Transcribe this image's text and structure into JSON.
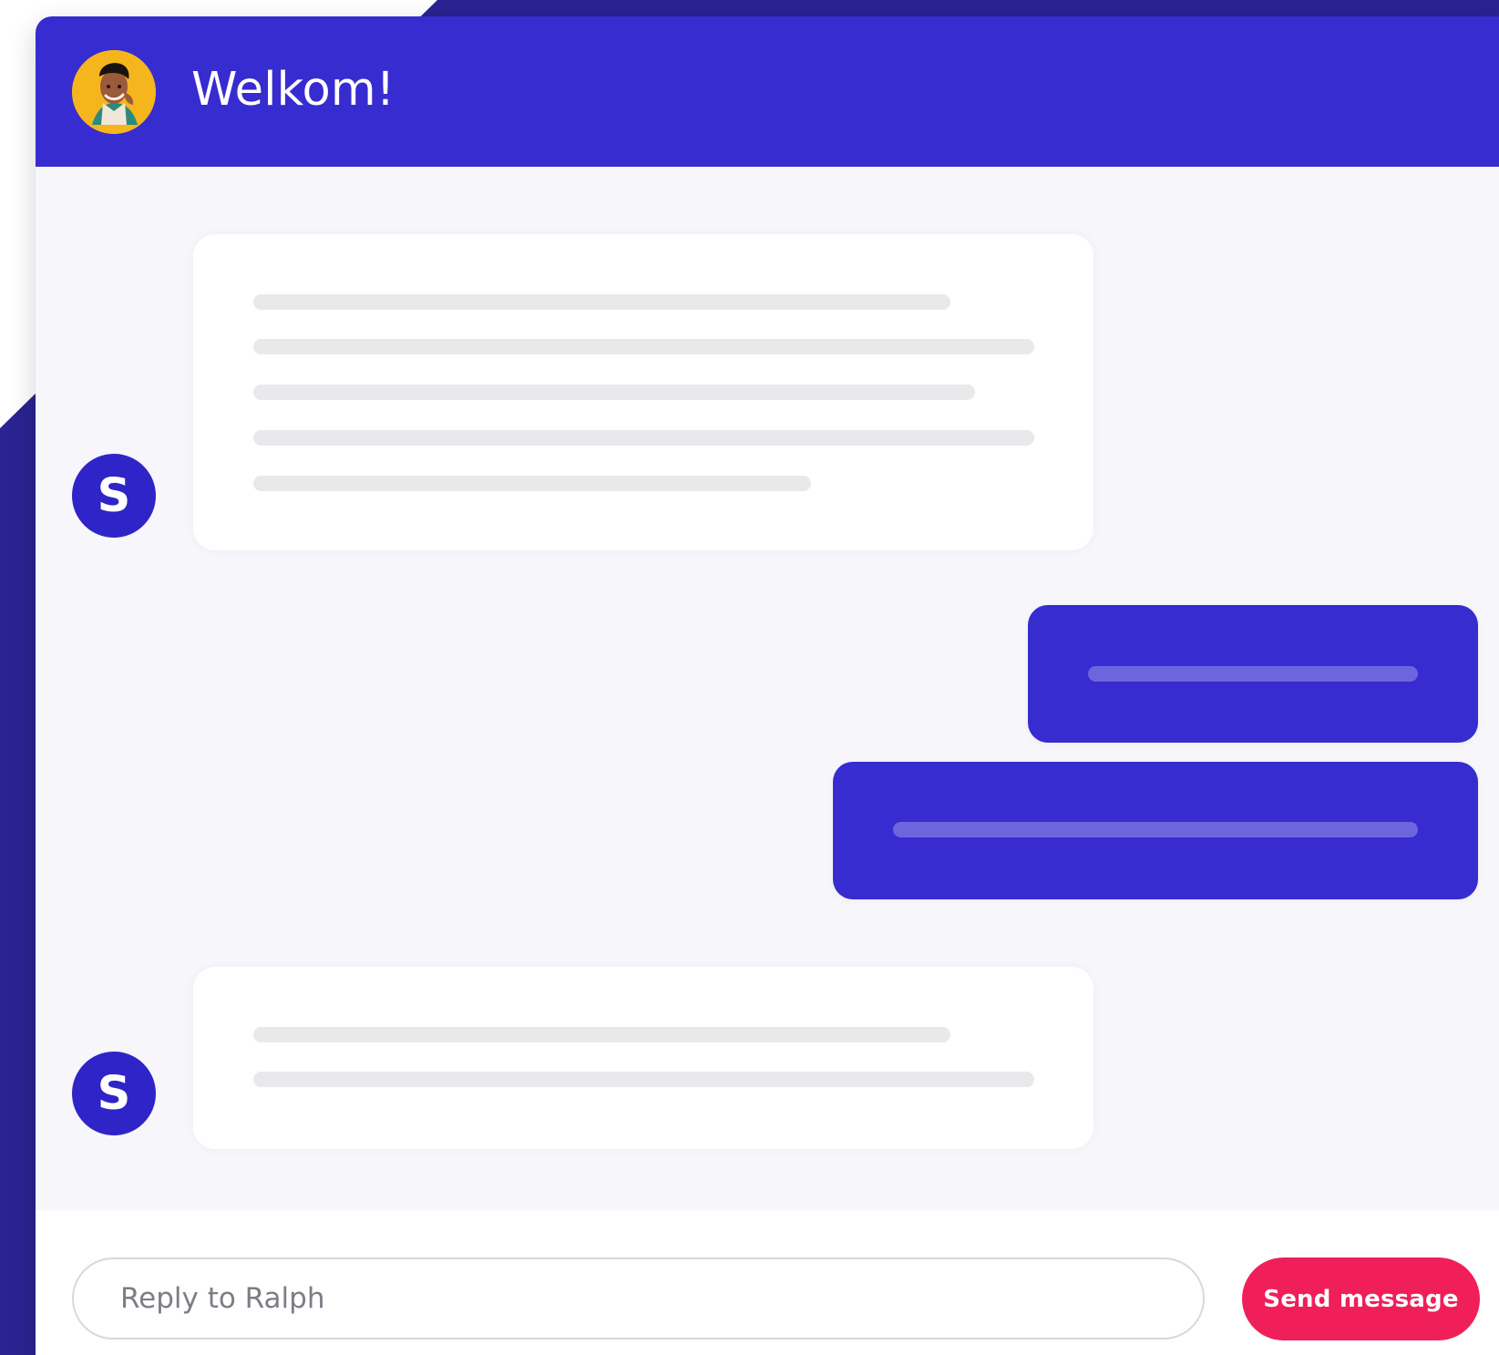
{
  "header": {
    "title": "Welkom!",
    "avatar_icon": "user-photo-avatar-icon"
  },
  "messages": [
    {
      "direction": "incoming",
      "sender_initial": "S",
      "skeleton_lines": 5
    },
    {
      "direction": "outgoing",
      "skeleton_lines": 1
    },
    {
      "direction": "outgoing",
      "skeleton_lines": 1
    },
    {
      "direction": "incoming",
      "sender_initial": "S",
      "skeleton_lines": 2
    }
  ],
  "composer": {
    "input_value": "",
    "input_placeholder": "Reply to Ralph",
    "send_label": "Send message"
  },
  "colors": {
    "primary": "#372ccf",
    "background": "#f6f6fb",
    "accent": "#f01f59",
    "surface": "#ffffff",
    "skeleton": "#e9e9eb"
  }
}
